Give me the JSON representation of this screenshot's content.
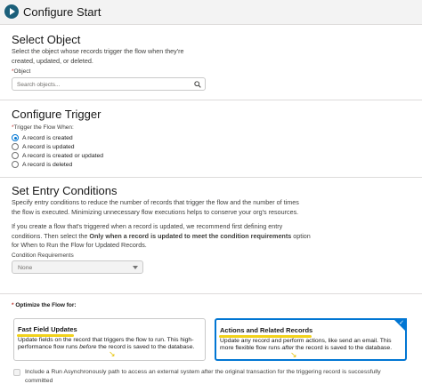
{
  "header": {
    "title": "Configure Start",
    "icon": "play-icon"
  },
  "select_object": {
    "heading": "Select Object",
    "description": "Select the object whose records trigger the flow when they're created, updated, or deleted.",
    "field_label": "Object",
    "required_marker": "*",
    "search_placeholder": "Search objects...",
    "search_icon": "search-icon"
  },
  "configure_trigger": {
    "heading": "Configure Trigger",
    "field_label": "Trigger the Flow When:",
    "required_marker": "*",
    "options": [
      {
        "label": "A record is created",
        "selected": true
      },
      {
        "label": "A record is updated",
        "selected": false
      },
      {
        "label": "A record is created or updated",
        "selected": false
      },
      {
        "label": "A record is deleted",
        "selected": false
      }
    ]
  },
  "entry_conditions": {
    "heading": "Set Entry Conditions",
    "description": "Specify entry conditions to reduce the number of records that trigger the flow and the number of times the flow is executed. Minimizing unnecessary flow executions helps to conserve your org's resources.",
    "note_part1": "If you create a flow that's triggered when a record is updated, we recommend first defining entry conditions. Then select the ",
    "note_bold": "Only when a record is updated to meet the condition requirements",
    "note_part2": " option for When to Run the Flow for Updated Records.",
    "condition_label": "Condition Requirements",
    "condition_value": "None"
  },
  "optimize": {
    "label": "Optimize the Flow for:",
    "required_marker": "*",
    "cards": [
      {
        "title": "Fast Field Updates",
        "desc_part1": "Update fields on the record that triggers the flow to run. This high-performance flow runs ",
        "desc_em": "before",
        "desc_part2": " the record is saved to the database.",
        "selected": false
      },
      {
        "title": "Actions and Related Records",
        "desc_part1": "Update any record and perform actions, like send an email. This more flexible flow runs ",
        "desc_em": "after",
        "desc_part2": " the record is saved to the database.",
        "selected": true
      }
    ],
    "async_label": "Include a Run Asynchronously path to access an external system after the original transaction for the triggering record is successfully committed"
  },
  "colors": {
    "accent": "#0176d3",
    "highlight": "#f2d21a",
    "header_bg": "#f3f3f3"
  }
}
